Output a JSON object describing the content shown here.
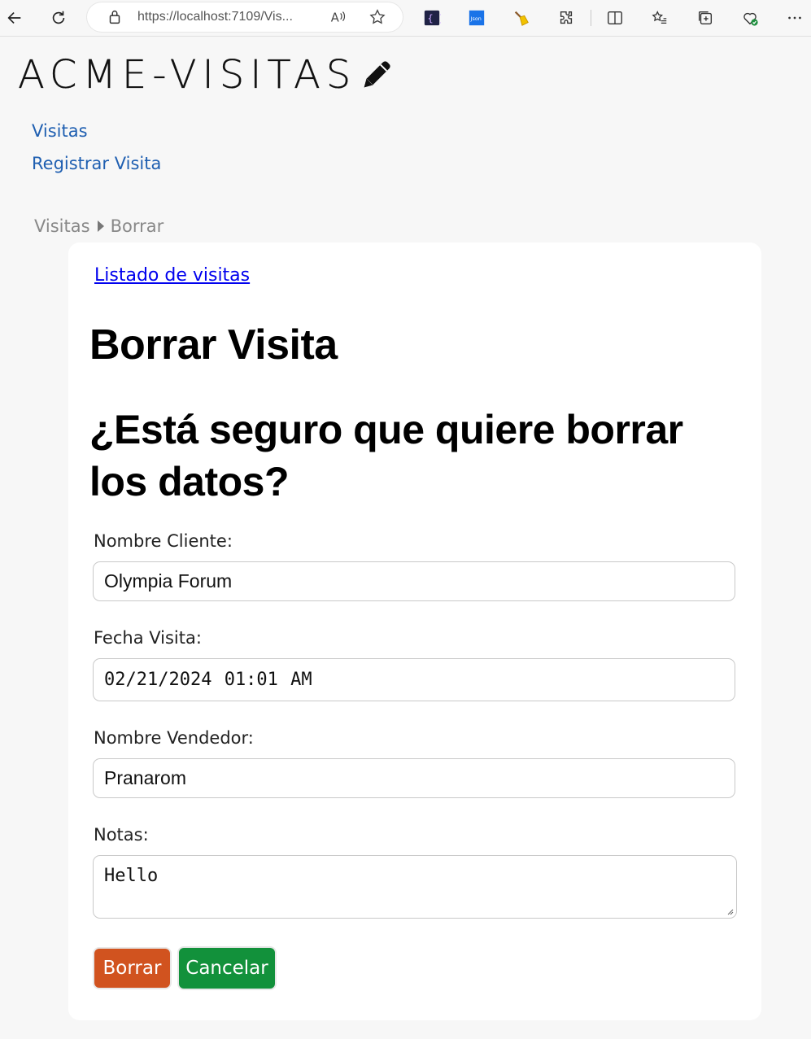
{
  "browser": {
    "url": "https://localhost:7109/Vis...",
    "read_aloud_label": "Ȃ",
    "json_ext_label": "Json"
  },
  "site": {
    "logo_text": "ACME-VISITAS"
  },
  "nav": {
    "items": [
      {
        "label": "Visitas"
      },
      {
        "label": "Registrar Visita"
      }
    ]
  },
  "breadcrumb": {
    "parent": "Visitas",
    "current": "Borrar"
  },
  "page": {
    "back_link": "Listado de visitas",
    "title": "Borrar Visita",
    "confirm_text": "¿Está seguro que quiere borrar los datos?"
  },
  "form": {
    "cliente_label": "Nombre Cliente:",
    "cliente_value": "Olympia Forum",
    "fecha_label": "Fecha Visita:",
    "fecha_value": "02/21/2024 01:01 AM",
    "vendedor_label": "Nombre Vendedor:",
    "vendedor_value": "Pranarom",
    "notas_label": "Notas:",
    "notas_value": "Hello"
  },
  "buttons": {
    "delete_label": "Borrar",
    "cancel_label": "Cancelar"
  },
  "colors": {
    "link": "#1f5fb1",
    "delete_button": "#d1531f",
    "cancel_button": "#12913b"
  }
}
